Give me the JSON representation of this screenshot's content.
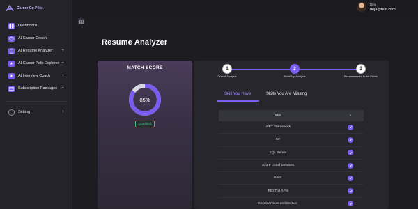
{
  "brand": {
    "name": "Career Co Pilot"
  },
  "sidebar": {
    "items": [
      {
        "label": "Dashboard",
        "icon": "grid-icon",
        "arrow": ""
      },
      {
        "label": "AI Career Coach",
        "icon": "brain-icon",
        "arrow": ""
      },
      {
        "label": "AI Resume Analyzer",
        "icon": "document-icon",
        "arrow": "+"
      },
      {
        "label": "AI Career Path Explorer",
        "icon": "compass-icon",
        "arrow": "+"
      },
      {
        "label": "AI Interview Coach",
        "icon": "microphone-icon",
        "arrow": "+"
      },
      {
        "label": "Subscription Packages",
        "icon": "card-icon",
        "arrow": "+"
      }
    ],
    "setting": {
      "label": "Setting",
      "icon": "gear-icon",
      "arrow": "+"
    }
  },
  "user": {
    "name": "Deja",
    "email": "deja@test.com"
  },
  "page": {
    "title": "Resume Analyzer"
  },
  "match": {
    "title": "MATCH SCORE",
    "score_text": "85%",
    "score_value": 85,
    "badge": "Qualified"
  },
  "stepper": {
    "steps": [
      {
        "number": "1",
        "label": "Overall Analysis",
        "state": "done"
      },
      {
        "number": "2",
        "label": "SkillsGap Analysis",
        "state": "active"
      },
      {
        "number": "3",
        "label": "Recommended Bullet Points",
        "state": "upcoming"
      }
    ]
  },
  "tabs": {
    "have": "Skill You Have",
    "missing": "Skills You Are Missing"
  },
  "table": {
    "header_skill": "Skill",
    "header_check": "+",
    "rows": [
      {
        "skill": ".NET Framework"
      },
      {
        "skill": "C#"
      },
      {
        "skill": "SQL Server"
      },
      {
        "skill": "Azure Cloud Services"
      },
      {
        "skill": "AWS"
      },
      {
        "skill": "RESTful APIs"
      },
      {
        "skill": "Microservices architecture"
      }
    ]
  },
  "colors": {
    "accent": "#7a5cf0",
    "qualified": "#3ec27a",
    "background": "#1c1c21"
  }
}
